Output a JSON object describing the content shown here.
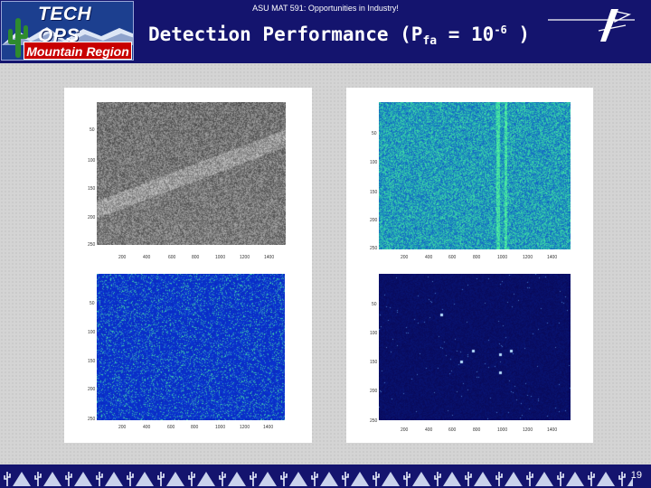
{
  "header": {
    "subtitle": "ASU MAT 591: Opportunities in Industry!",
    "title_main": "Detection Performance (P",
    "title_sub": "fa",
    "title_eq": " = 10",
    "title_exp": "-6",
    "title_end": " )"
  },
  "logo": {
    "top_text": "TECH OPS",
    "bottom_text": "Mountain Region"
  },
  "plots": [
    {
      "id": "top-left",
      "colormap": "gray",
      "yticks": [
        "50",
        "100",
        "150",
        "200",
        "250"
      ],
      "xticks": [
        "200",
        "400",
        "600",
        "800",
        "1000",
        "1200",
        "1400"
      ]
    },
    {
      "id": "top-right",
      "colormap": "blue-green",
      "yticks": [
        "50",
        "100",
        "150",
        "200",
        "250"
      ],
      "xticks": [
        "200",
        "400",
        "600",
        "800",
        "1000",
        "1200",
        "1400"
      ]
    },
    {
      "id": "bottom-left",
      "colormap": "blue-speckle",
      "yticks": [
        "50",
        "100",
        "150",
        "200",
        "250"
      ],
      "xticks": [
        "200",
        "400",
        "600",
        "800",
        "1000",
        "1200",
        "1400"
      ]
    },
    {
      "id": "bottom-right",
      "colormap": "dark-blue-detections",
      "yticks": [
        "50",
        "100",
        "150",
        "200",
        "250"
      ],
      "xticks": [
        "200",
        "400",
        "600",
        "800",
        "1000",
        "1200",
        "1400"
      ]
    }
  ],
  "footer": {
    "page_number": "19"
  },
  "colors": {
    "header_bg": "#14146e",
    "logo_red": "#c80000"
  }
}
